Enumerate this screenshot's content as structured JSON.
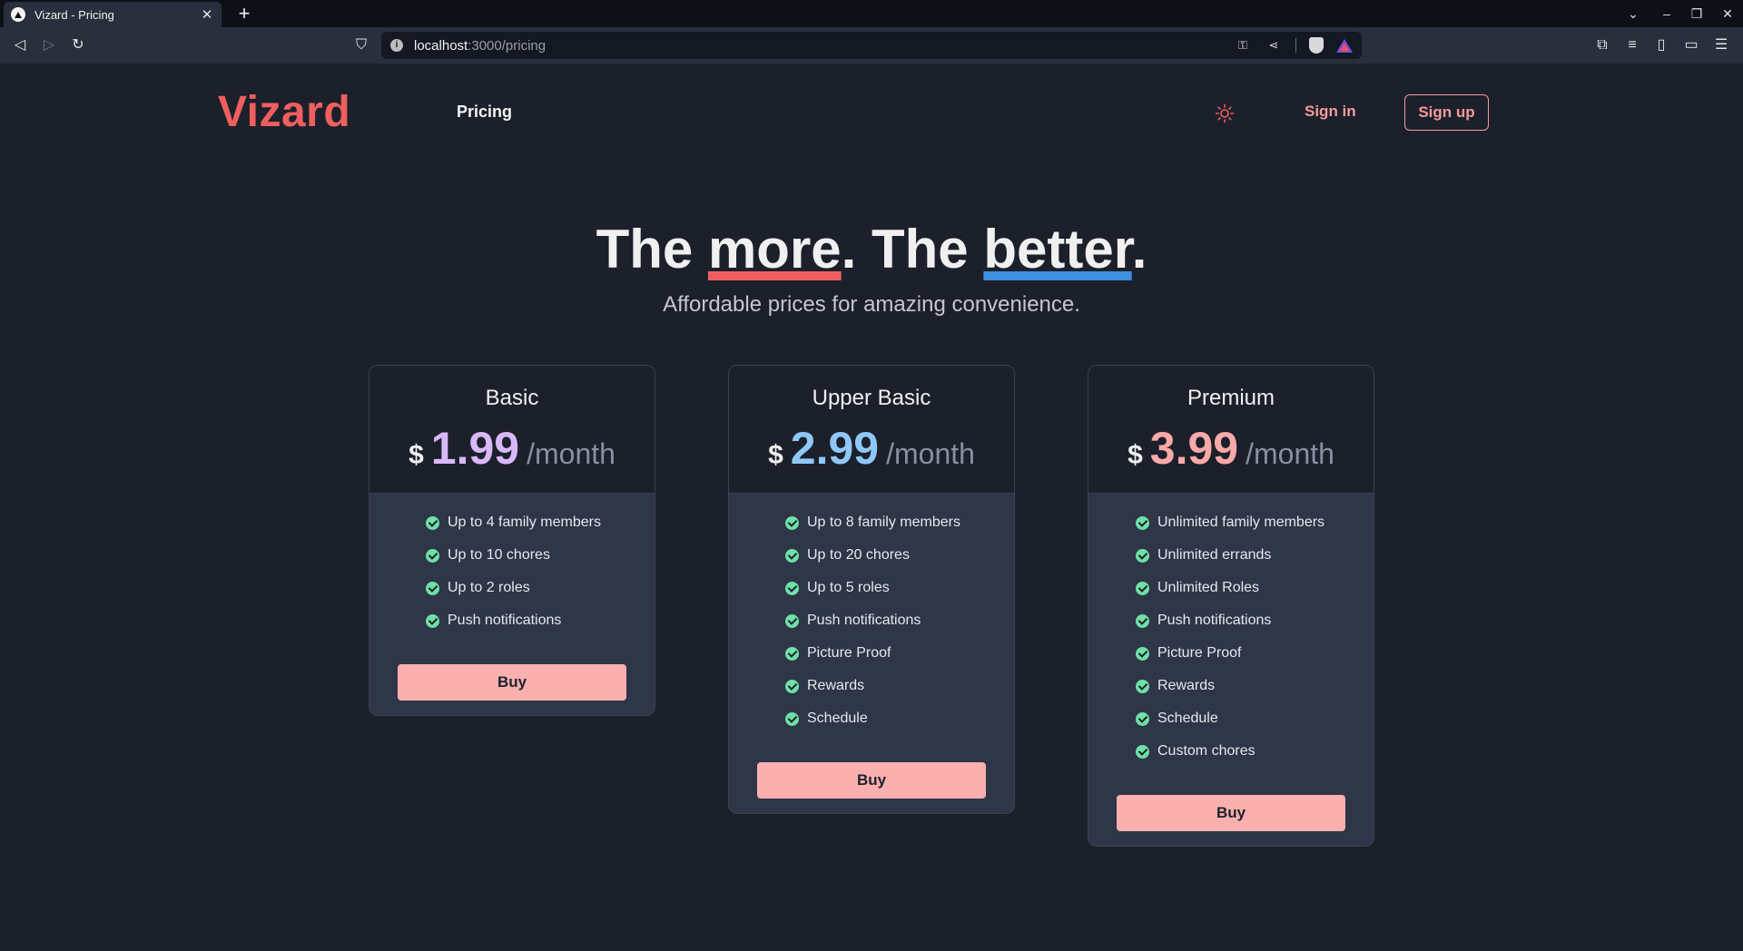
{
  "browser": {
    "tab_title": "Vizard - Pricing",
    "url_host": "localhost",
    "url_path": ":3000/pricing"
  },
  "header": {
    "logo": "Vizard",
    "nav_pricing": "Pricing",
    "sign_in": "Sign in",
    "sign_up": "Sign up"
  },
  "hero": {
    "title_part1": "The ",
    "title_word1": "more",
    "title_part2": ". The ",
    "title_word2": "better",
    "title_part3": ".",
    "subtitle": "Affordable prices for amazing convenience."
  },
  "plans": [
    {
      "name": "Basic",
      "currency": "$",
      "price": "1.99",
      "period": "/month",
      "price_color": "#d9b8fa",
      "features": [
        "Up to 4 family members",
        "Up to 10 chores",
        "Up to 2 roles",
        "Push notifications"
      ],
      "buy_label": "Buy"
    },
    {
      "name": "Upper Basic",
      "currency": "$",
      "price": "2.99",
      "period": "/month",
      "price_color": "#8fc8f8",
      "features": [
        "Up to 8 family members",
        "Up to 20 chores",
        "Up to 5 roles",
        "Push notifications",
        "Picture Proof",
        "Rewards",
        "Schedule"
      ],
      "buy_label": "Buy"
    },
    {
      "name": "Premium",
      "currency": "$",
      "price": "3.99",
      "period": "/month",
      "price_color": "#f8aaa8",
      "features": [
        "Unlimited family members",
        "Unlimited errands",
        "Unlimited Roles",
        "Push notifications",
        "Picture Proof",
        "Rewards",
        "Schedule",
        "Custom chores"
      ],
      "buy_label": "Buy"
    }
  ],
  "icons": {
    "theme_toggle": "sun-icon",
    "feature_check": "check-circle-icon"
  },
  "colors": {
    "background": "#1c202b",
    "brand": "#ef5f5f",
    "accent_pink": "#f49b9b",
    "buy_button": "#fbb0b0",
    "check": "#6ee0a8",
    "underline_red": "#ef5f5f",
    "underline_blue": "#3d8fe0"
  }
}
